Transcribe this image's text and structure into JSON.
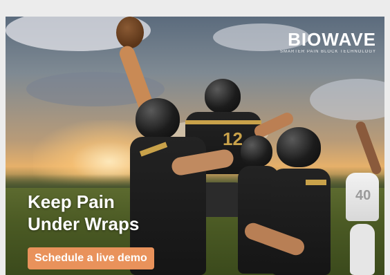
{
  "brand": {
    "name": "BIOWAVE",
    "tagline": "SMARTER PAIN BLOCK TECHNOLOGY"
  },
  "headline": {
    "line1": "Keep Pain",
    "line2": "Under Wraps"
  },
  "cta": {
    "label": "Schedule a live demo"
  },
  "jersey_numbers": {
    "center_player": "12",
    "opponent": "40"
  },
  "colors": {
    "cta_background": "#e9925b",
    "page_background": "#ececec",
    "jersey_accent": "#c9a24a"
  }
}
